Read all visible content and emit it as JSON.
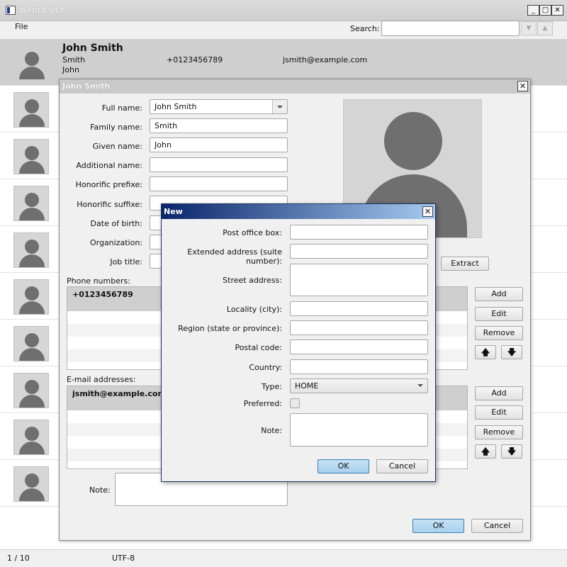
{
  "window": {
    "title": "demo.vcf",
    "minimize": "_",
    "maximize": "□",
    "close": "✕"
  },
  "menu": {
    "file": "File"
  },
  "search": {
    "label": "Search:",
    "value": ""
  },
  "contacts": {
    "selected": {
      "name": "John Smith",
      "family": "Smith",
      "given": "John",
      "phone": "+0123456789",
      "email": "jsmith@example.com"
    }
  },
  "status": {
    "page": "1 / 10",
    "encoding": "UTF-8"
  },
  "contact_dialog": {
    "title": "John Smith",
    "labels": {
      "full_name": "Full name:",
      "family_name": "Family name:",
      "given_name": "Given name:",
      "additional_name": "Additional name:",
      "honorific_prefixe": "Honorific prefixe:",
      "honorific_suffixe": "Honorific suffixe:",
      "date_of_birth": "Date of birth:",
      "organization": "Organization:",
      "job_title": "Job title:",
      "phone_numbers": "Phone numbers:",
      "email_addresses": "E-mail addresses:",
      "note": "Note:"
    },
    "values": {
      "full_name": "John Smith",
      "family_name": "Smith",
      "given_name": "John"
    },
    "phones": [
      "+0123456789"
    ],
    "emails": [
      "jsmith@example.com"
    ],
    "buttons": {
      "extract": "Extract",
      "add": "Add",
      "edit": "Edit",
      "remove": "Remove",
      "up": "🡅",
      "down": "🡇",
      "ok": "OK",
      "cancel": "Cancel"
    }
  },
  "new_dialog": {
    "title": "New",
    "labels": {
      "po_box": "Post office box:",
      "extended": "Extended address (suite number):",
      "street": "Street address:",
      "locality": "Locality (city):",
      "region": "Region (state or province):",
      "postal": "Postal code:",
      "country": "Country:",
      "type": "Type:",
      "preferred": "Preferred:",
      "note": "Note:"
    },
    "type_value": "HOME",
    "buttons": {
      "ok": "OK",
      "cancel": "Cancel"
    }
  }
}
